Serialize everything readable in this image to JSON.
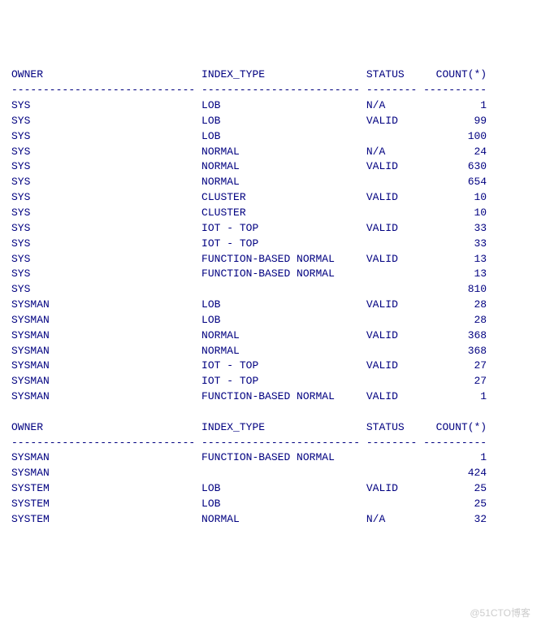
{
  "columns": {
    "owner": "OWNER",
    "index_type": "INDEX_TYPE",
    "status": "STATUS",
    "count": "COUNT(*)"
  },
  "widths": {
    "owner": 30,
    "index_type": 26,
    "status": 9,
    "count": 10
  },
  "blocks": [
    {
      "header": true,
      "rows": [
        {
          "owner": "SYS",
          "index_type": "LOB",
          "status": "N/A",
          "count": 1
        },
        {
          "owner": "SYS",
          "index_type": "LOB",
          "status": "VALID",
          "count": 99
        },
        {
          "owner": "SYS",
          "index_type": "LOB",
          "status": "",
          "count": 100
        },
        {
          "owner": "SYS",
          "index_type": "NORMAL",
          "status": "N/A",
          "count": 24
        },
        {
          "owner": "SYS",
          "index_type": "NORMAL",
          "status": "VALID",
          "count": 630
        },
        {
          "owner": "SYS",
          "index_type": "NORMAL",
          "status": "",
          "count": 654
        },
        {
          "owner": "SYS",
          "index_type": "CLUSTER",
          "status": "VALID",
          "count": 10
        },
        {
          "owner": "SYS",
          "index_type": "CLUSTER",
          "status": "",
          "count": 10
        },
        {
          "owner": "SYS",
          "index_type": "IOT - TOP",
          "status": "VALID",
          "count": 33
        },
        {
          "owner": "SYS",
          "index_type": "IOT - TOP",
          "status": "",
          "count": 33
        },
        {
          "owner": "SYS",
          "index_type": "FUNCTION-BASED NORMAL",
          "status": "VALID",
          "count": 13
        },
        {
          "owner": "SYS",
          "index_type": "FUNCTION-BASED NORMAL",
          "status": "",
          "count": 13
        },
        {
          "owner": "SYS",
          "index_type": "",
          "status": "",
          "count": 810
        },
        {
          "owner": "SYSMAN",
          "index_type": "LOB",
          "status": "VALID",
          "count": 28
        },
        {
          "owner": "SYSMAN",
          "index_type": "LOB",
          "status": "",
          "count": 28
        },
        {
          "owner": "SYSMAN",
          "index_type": "NORMAL",
          "status": "VALID",
          "count": 368
        },
        {
          "owner": "SYSMAN",
          "index_type": "NORMAL",
          "status": "",
          "count": 368
        },
        {
          "owner": "SYSMAN",
          "index_type": "IOT - TOP",
          "status": "VALID",
          "count": 27
        },
        {
          "owner": "SYSMAN",
          "index_type": "IOT - TOP",
          "status": "",
          "count": 27
        },
        {
          "owner": "SYSMAN",
          "index_type": "FUNCTION-BASED NORMAL",
          "status": "VALID",
          "count": 1
        }
      ]
    },
    {
      "header": true,
      "rows": [
        {
          "owner": "SYSMAN",
          "index_type": "FUNCTION-BASED NORMAL",
          "status": "",
          "count": 1
        },
        {
          "owner": "SYSMAN",
          "index_type": "",
          "status": "",
          "count": 424
        },
        {
          "owner": "SYSTEM",
          "index_type": "LOB",
          "status": "VALID",
          "count": 25
        },
        {
          "owner": "SYSTEM",
          "index_type": "LOB",
          "status": "",
          "count": 25
        },
        {
          "owner": "SYSTEM",
          "index_type": "NORMAL",
          "status": "N/A",
          "count": 32
        }
      ]
    }
  ],
  "watermark": "@51CTO博客"
}
